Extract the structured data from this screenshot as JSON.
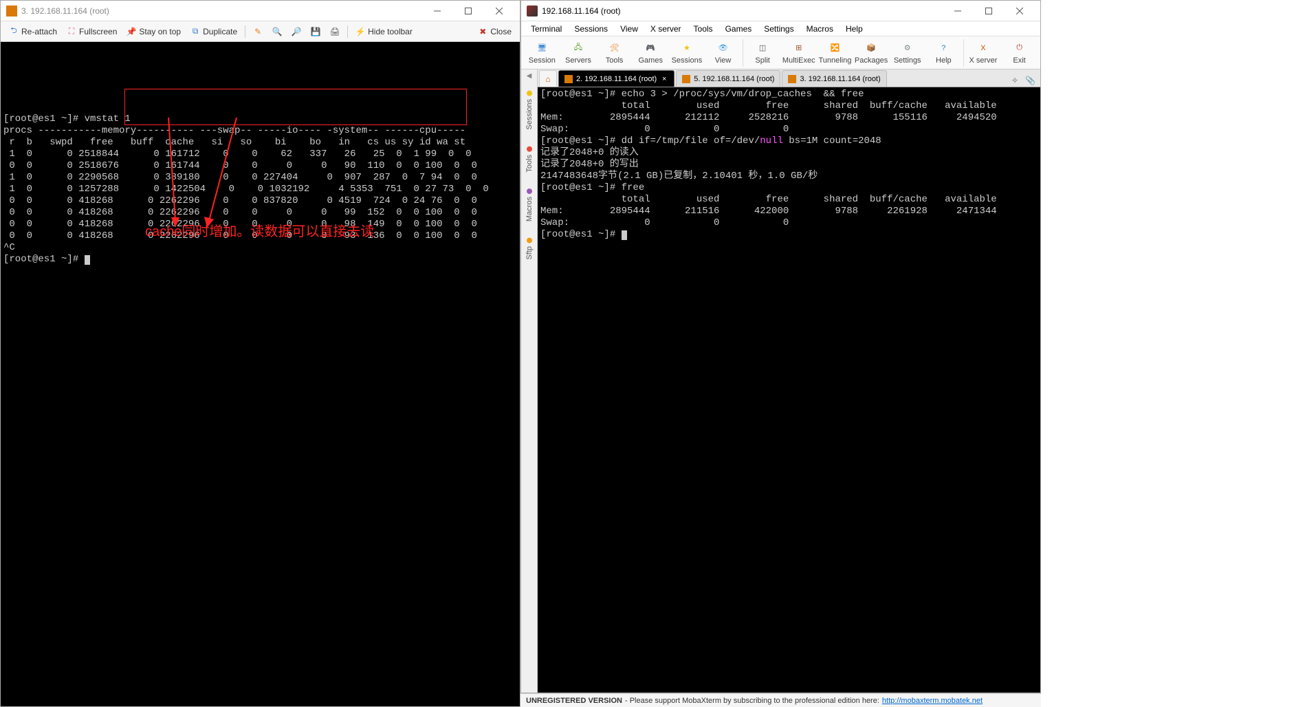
{
  "left_window": {
    "title": "3. 192.168.11.164 (root)",
    "toolbar": {
      "reattach": "Re-attach",
      "fullscreen": "Fullscreen",
      "stayontop": "Stay on top",
      "duplicate": "Duplicate",
      "hidetoolbar": "Hide toolbar",
      "close": "Close"
    },
    "terminal_lines": [
      {
        "segs": [
          {
            "t": "[root@es1 ~]# ",
            "c": ""
          },
          {
            "t": "vmstat 1",
            "c": ""
          }
        ]
      },
      {
        "segs": [
          {
            "t": "procs -----------memory---------- ---swap-- -----io---- -system-- ------cpu-----",
            "c": ""
          }
        ]
      },
      {
        "segs": [
          {
            "t": " r  b   swpd   free   buff  cache   si   so    bi    bo   in   cs us sy id wa st",
            "c": ""
          }
        ]
      },
      {
        "segs": [
          {
            "t": " 1  0      0 2518844      0 161712    0    0    62   337   26   25  0  1 99  0  0",
            "c": ""
          }
        ]
      },
      {
        "segs": [
          {
            "t": " 0  0      0 2518676      0 161744    0    0     0     0   90  110  0  0 100  0  0",
            "c": ""
          }
        ]
      },
      {
        "segs": [
          {
            "t": " 1  0      0 2290568      0 389180    0    0 227404     0  907  287  0  7 94  0  0",
            "c": ""
          }
        ]
      },
      {
        "segs": [
          {
            "t": " 1  0      0 1257288      0 1422504    0    0 1032192     4 5353  751  0 27 73  0  0",
            "c": ""
          }
        ]
      },
      {
        "segs": [
          {
            "t": " 0  0      0 418268      0 2262296    0    0 837820     0 4519  724  0 24 76  0  0",
            "c": ""
          }
        ]
      },
      {
        "segs": [
          {
            "t": " 0  0      0 418268      0 2262296    0    0     0     0   99  152  0  0 100  0  0",
            "c": ""
          }
        ]
      },
      {
        "segs": [
          {
            "t": " 0  0      0 418268      0 2262296    0    0     0     0   98  149  0  0 100  0  0",
            "c": ""
          }
        ]
      },
      {
        "segs": [
          {
            "t": " 0  0      0 418268      0 2262296    0    0     0     0   93  136  0  0 100  0  0",
            "c": ""
          }
        ]
      },
      {
        "segs": [
          {
            "t": "^C",
            "c": ""
          }
        ]
      },
      {
        "segs": [
          {
            "t": "[root@es1 ~]# ",
            "c": ""
          }
        ],
        "cursor": true
      }
    ],
    "annotation": "cache同时增加。读数据可以直接去读"
  },
  "right_window": {
    "title": "192.168.11.164 (root)",
    "menu": [
      "Terminal",
      "Sessions",
      "View",
      "X server",
      "Tools",
      "Games",
      "Settings",
      "Macros",
      "Help"
    ],
    "bigtoolbar": [
      {
        "label": "Session",
        "color": "#4a90d9"
      },
      {
        "label": "Servers",
        "color": "#5aa02c"
      },
      {
        "label": "Tools",
        "color": "#e67e22"
      },
      {
        "label": "Games",
        "color": "#8e44ad"
      },
      {
        "label": "Sessions",
        "color": "#f1c40f"
      },
      {
        "label": "View",
        "color": "#3498db"
      },
      {
        "label": "Split",
        "color": "#555"
      },
      {
        "label": "MultiExec",
        "color": "#a0522d"
      },
      {
        "label": "Tunneling",
        "color": "#16a085"
      },
      {
        "label": "Packages",
        "color": "#c0392b"
      },
      {
        "label": "Settings",
        "color": "#7f8c8d"
      },
      {
        "label": "Help",
        "color": "#2980b9"
      },
      {
        "label": "X server",
        "color": "#d35400"
      },
      {
        "label": "Exit",
        "color": "#c0392b"
      }
    ],
    "tabs": [
      {
        "label": "2. 192.168.11.164 (root)",
        "active": true
      },
      {
        "label": "5. 192.168.11.164 (root)",
        "active": false
      },
      {
        "label": "3. 192.168.11.164 (root)",
        "active": false
      }
    ],
    "sidetabs": [
      {
        "label": "Sessions",
        "color": "#f1c40f"
      },
      {
        "label": "Tools",
        "color": "#e74c3c"
      },
      {
        "label": "Macros",
        "color": "#9b59b6"
      },
      {
        "label": "Sftp",
        "color": "#f39c12"
      }
    ],
    "terminal_lines": [
      {
        "segs": [
          {
            "t": "[root@es1 ~]# echo 3 > /proc/sys/vm/drop_caches  && free",
            "c": ""
          }
        ]
      },
      {
        "segs": [
          {
            "t": "              total        used        free      shared  buff/cache   available",
            "c": ""
          }
        ]
      },
      {
        "segs": [
          {
            "t": "Mem:        2895444      212112     2528216        9788      155116     2494520",
            "c": ""
          }
        ]
      },
      {
        "segs": [
          {
            "t": "Swap:             0           0           0",
            "c": ""
          }
        ]
      },
      {
        "segs": [
          {
            "t": "[root@es1 ~]# dd if=/tmp/file of=/dev/",
            "c": ""
          },
          {
            "t": "null",
            "c": "m"
          },
          {
            "t": " bs=1M count=2048",
            "c": ""
          }
        ]
      },
      {
        "segs": [
          {
            "t": "记录了2048+0 的读入",
            "c": ""
          }
        ]
      },
      {
        "segs": [
          {
            "t": "记录了2048+0 的写出",
            "c": ""
          }
        ]
      },
      {
        "segs": [
          {
            "t": "2147483648字节(2.1 GB)已复制，2.10401 秒，1.0 GB/秒",
            "c": ""
          }
        ]
      },
      {
        "segs": [
          {
            "t": "[root@es1 ~]# free",
            "c": ""
          }
        ]
      },
      {
        "segs": [
          {
            "t": "              total        used        free      shared  buff/cache   available",
            "c": ""
          }
        ]
      },
      {
        "segs": [
          {
            "t": "Mem:        2895444      211516      422000        9788     2261928     2471344",
            "c": ""
          }
        ]
      },
      {
        "segs": [
          {
            "t": "Swap:             0           0           0",
            "c": ""
          }
        ]
      },
      {
        "segs": [
          {
            "t": "[root@es1 ~]# ",
            "c": ""
          }
        ],
        "cursor": true
      }
    ],
    "footer": {
      "bold": "UNREGISTERED VERSION",
      "text": " -  Please support MobaXterm by subscribing to the professional edition here:  ",
      "link": "http://mobaxterm.mobatek.net"
    }
  }
}
